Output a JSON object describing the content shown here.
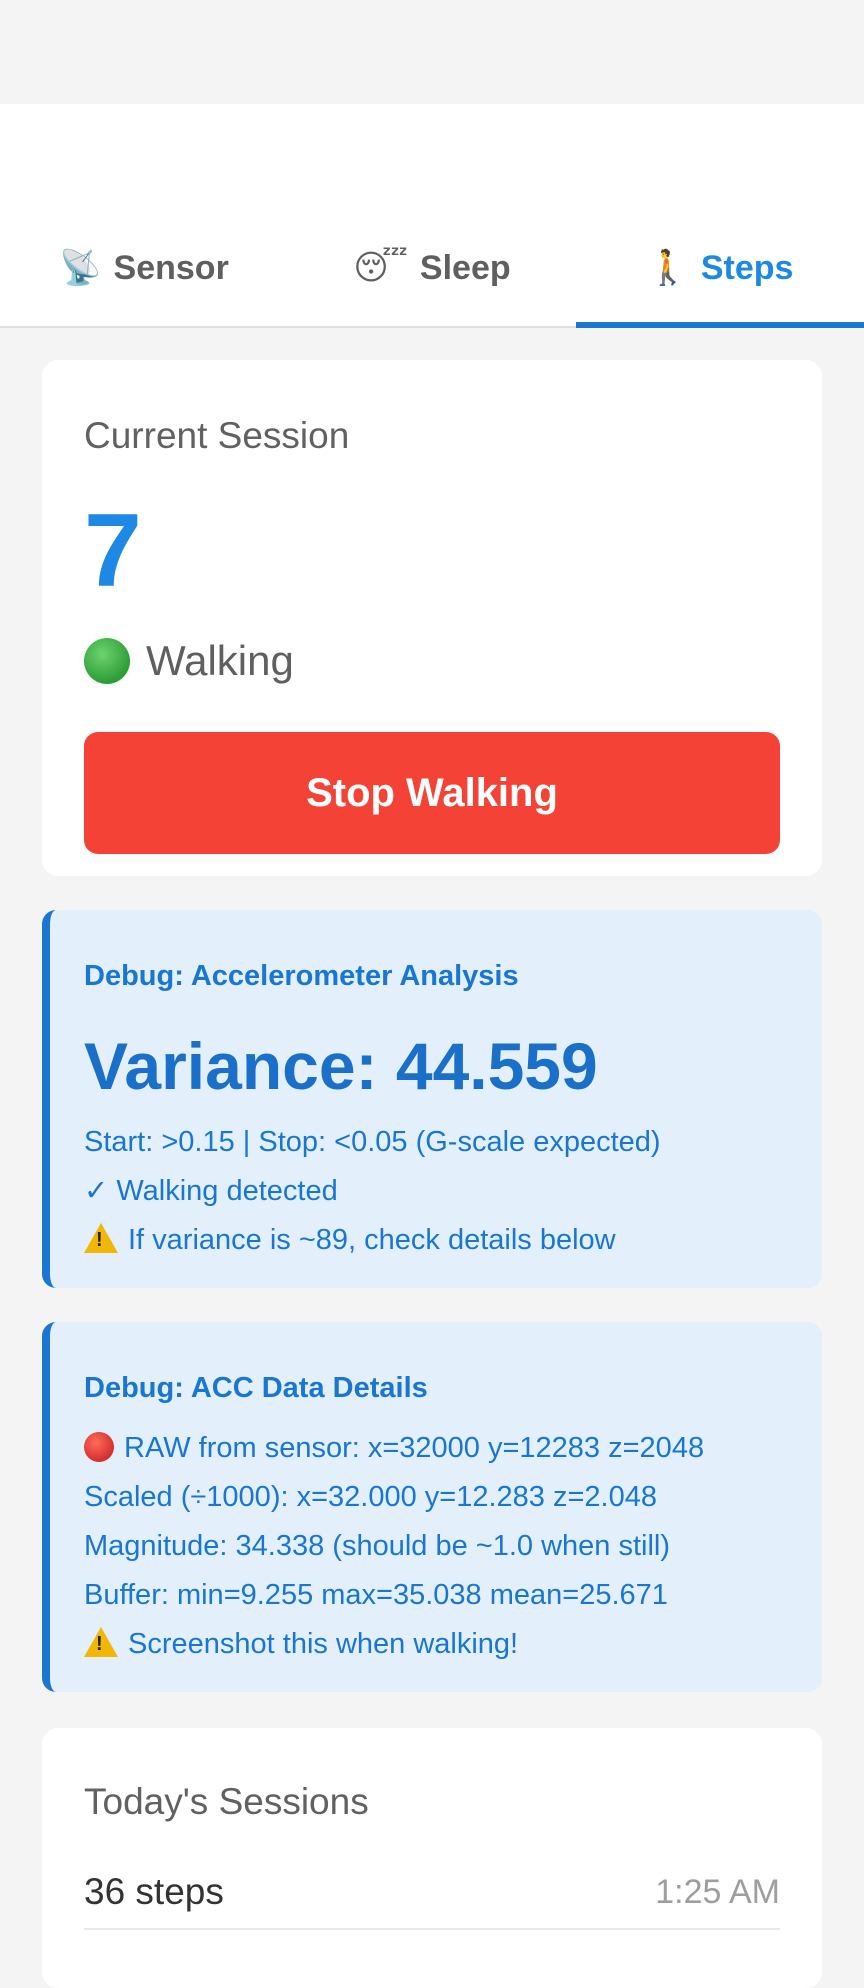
{
  "tabs": [
    {
      "label": "Sensor",
      "emoji": "📡",
      "icon": "satellite-dish-icon",
      "active": false
    },
    {
      "label": "Sleep",
      "emoji": "😴",
      "icon": "sleeping-face-icon",
      "active": false
    },
    {
      "label": "Steps",
      "emoji": "🚶",
      "icon": "walking-person-icon",
      "active": true
    }
  ],
  "session": {
    "title": "Current Session",
    "count": "7",
    "status": "Walking",
    "status_icon": "green-dot-icon",
    "stop_label": "Stop Walking"
  },
  "accel_debug": {
    "title": "Debug: Accelerometer Analysis",
    "variance": "Variance: 44.559",
    "thresholds": "Start: >0.15 | Stop: <0.05 (G-scale expected)",
    "detected": "✓ Walking detected",
    "warning": "If variance is ~89, check details below"
  },
  "acc_details": {
    "title": "Debug: ACC Data Details",
    "raw": "RAW from sensor: x=32000 y=12283 z=2048",
    "scaled": "Scaled (÷1000): x=32.000 y=12.283 z=2.048",
    "magnitude": "Magnitude: 34.338 (should be ~1.0 when still)",
    "buffer": "Buffer: min=9.255 max=35.038 mean=25.671",
    "warning": "Screenshot this when walking!"
  },
  "today": {
    "title": "Today's Sessions",
    "sessions": [
      {
        "steps": "36 steps",
        "time": "1:25 AM"
      }
    ]
  },
  "colors": {
    "accent": "#1e88e5",
    "stop_button": "#f44336",
    "debug_bg": "#e3f0fb"
  }
}
